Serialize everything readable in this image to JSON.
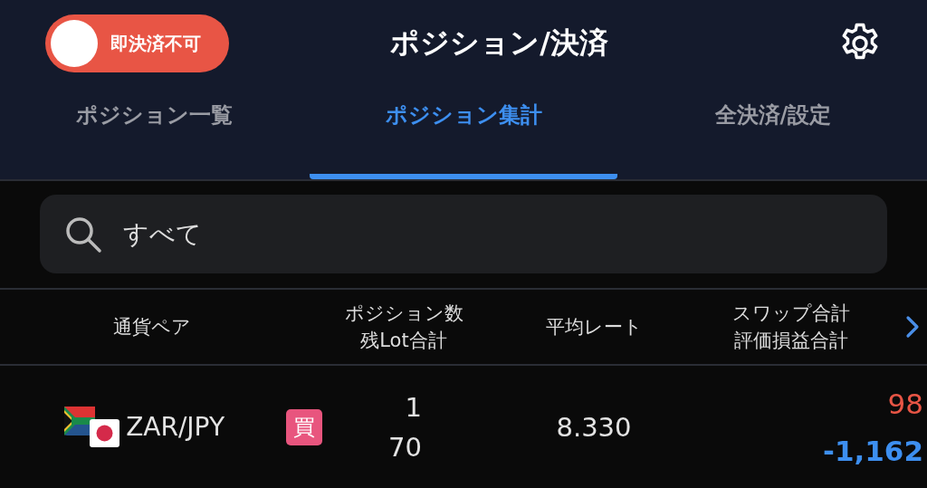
{
  "header": {
    "toggle": {
      "label": "即決済不可",
      "on": false
    },
    "title": "ポジション/決済"
  },
  "tabs": [
    {
      "label": "ポジション一覧",
      "selected": false
    },
    {
      "label": "ポジション集計",
      "selected": true
    },
    {
      "label": "全決済/設定",
      "selected": false
    }
  ],
  "search": {
    "value": "すべて"
  },
  "table": {
    "columns": [
      [
        "通貨ペア"
      ],
      [
        "ポジション数",
        "残Lot合計"
      ],
      [
        "平均レート"
      ],
      [
        "スワップ合計",
        "評価損益合計"
      ]
    ],
    "rows": [
      {
        "pair": "ZAR/JPY",
        "side": {
          "kind": "buy",
          "label": "買"
        },
        "positions": "1",
        "lots": "70",
        "rate": "8.330",
        "swap": "98",
        "pnl": "-1,162"
      }
    ]
  }
}
